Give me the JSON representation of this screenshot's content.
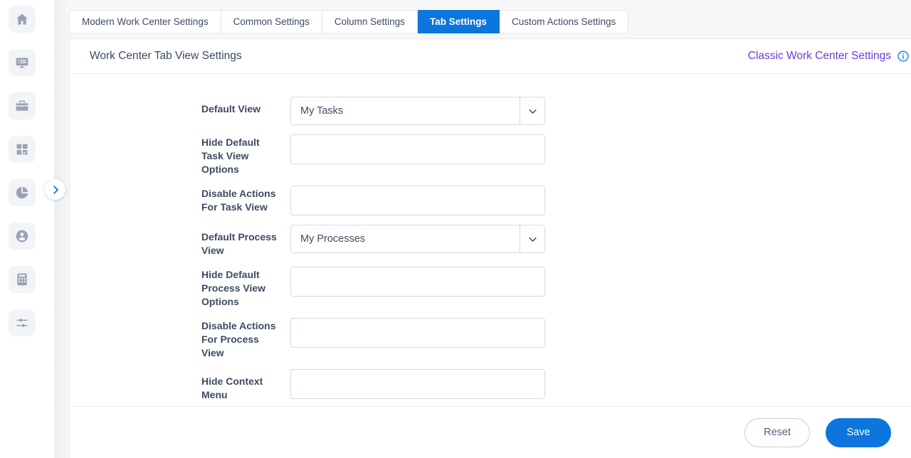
{
  "sidebar": {
    "items": [
      {
        "icon": "home-icon",
        "name": "sidebar-item-home"
      },
      {
        "icon": "dashboard-monitor-icon",
        "name": "sidebar-item-dashboard"
      },
      {
        "icon": "briefcase-icon",
        "name": "sidebar-item-work-center"
      },
      {
        "icon": "task-grid-icon",
        "name": "sidebar-item-tasks"
      },
      {
        "icon": "pie-chart-icon",
        "name": "sidebar-item-reports"
      },
      {
        "icon": "user-icon",
        "name": "sidebar-item-users"
      },
      {
        "icon": "calculator-icon",
        "name": "sidebar-item-calculator"
      },
      {
        "icon": "sliders-icon",
        "name": "sidebar-item-settings"
      }
    ],
    "toggle": {
      "icon": "chevron-right-icon",
      "label": "Expand navigation"
    }
  },
  "tabs": [
    {
      "label": "Modern Work Center Settings",
      "active": false
    },
    {
      "label": "Common Settings",
      "active": false
    },
    {
      "label": "Column Settings",
      "active": false
    },
    {
      "label": "Tab Settings",
      "active": true
    },
    {
      "label": "Custom Actions Settings",
      "active": false
    }
  ],
  "header": {
    "title": "Work Center Tab View Settings",
    "classic_link": "Classic Work Center Settings",
    "info_icon": "info-circle-icon"
  },
  "form": {
    "fields": [
      {
        "label": "Default View",
        "type": "select",
        "value": "My Tasks",
        "name": "default-view",
        "two_line": false
      },
      {
        "label": "Hide Default Task View Options",
        "type": "text",
        "value": "",
        "name": "hide-default-task-view-options",
        "two_line": true
      },
      {
        "label": "Disable Actions For Task View",
        "type": "text",
        "value": "",
        "name": "disable-actions-for-task-view",
        "two_line": true
      },
      {
        "label": "Default Process View",
        "type": "select",
        "value": "My Processes",
        "name": "default-process-view",
        "two_line": false
      },
      {
        "label": "Hide Default Process View Options",
        "type": "text",
        "value": "",
        "name": "hide-default-process-view-options",
        "two_line": true
      },
      {
        "label": "Disable Actions For Process View",
        "type": "text",
        "value": "",
        "name": "disable-actions-for-process-view",
        "two_line": true
      },
      {
        "label": "Hide Context Menu",
        "type": "text",
        "value": "",
        "name": "hide-context-menu",
        "two_line": false
      }
    ]
  },
  "footer": {
    "reset_label": "Reset",
    "save_label": "Save"
  },
  "colors": {
    "accent_blue": "#0c76de",
    "link_purple": "#6b3cd6",
    "label_text": "#3c4b63",
    "border": "#d6dae1",
    "rail_icon": "#9aa3b5"
  }
}
